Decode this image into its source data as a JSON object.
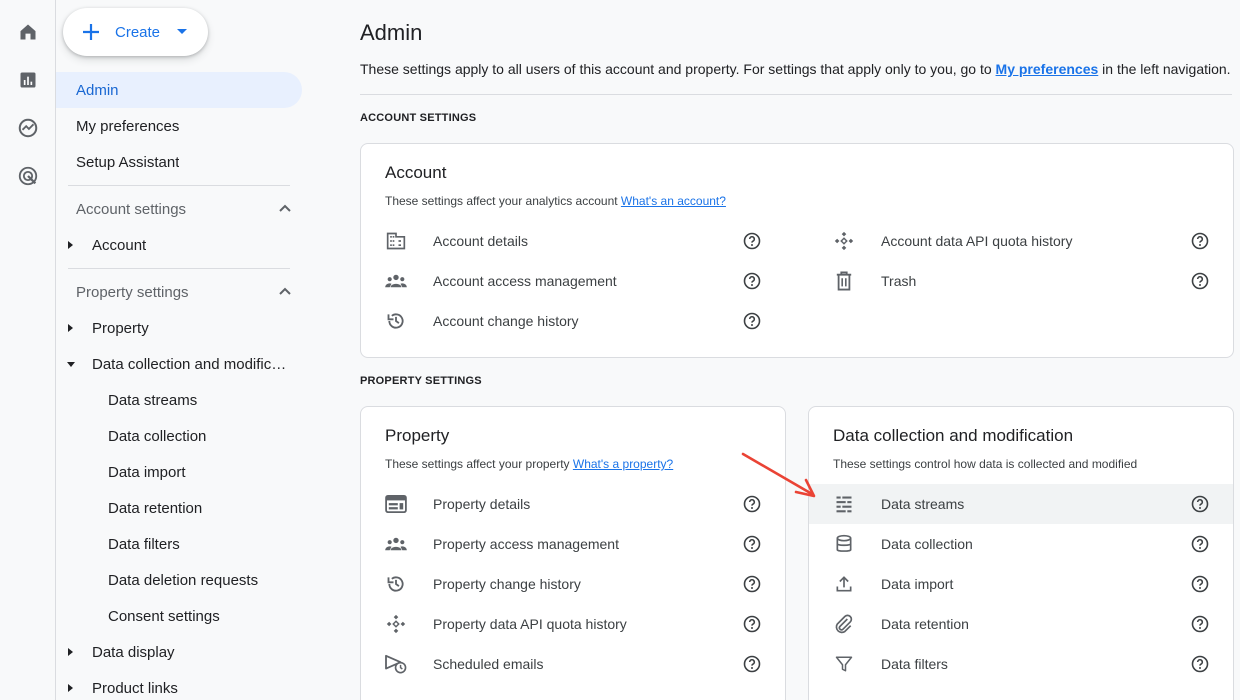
{
  "nav": {
    "create_label": "Create",
    "items": {
      "admin": "Admin",
      "my_preferences": "My preferences",
      "setup_assistant": "Setup Assistant"
    },
    "account_settings": {
      "header": "Account settings",
      "account": "Account"
    },
    "property_settings": {
      "header": "Property settings",
      "property": "Property",
      "data_collection": "Data collection and modification",
      "children": [
        "Data streams",
        "Data collection",
        "Data import",
        "Data retention",
        "Data filters",
        "Data deletion requests",
        "Consent settings"
      ],
      "data_display": "Data display",
      "product_links": "Product links"
    }
  },
  "main": {
    "title": "Admin",
    "description_prefix": "These settings apply to all users of this account and property. For settings that apply only to you, go to ",
    "description_link": "My preferences",
    "description_suffix": " in the left navigation.",
    "account_section_label": "ACCOUNT SETTINGS",
    "property_section_label": "PROPERTY SETTINGS",
    "account_card": {
      "title": "Account",
      "subtitle": "These settings affect your analytics account ",
      "subtitle_link": "What's an account?",
      "left_rows": [
        "Account details",
        "Account access management",
        "Account change history"
      ],
      "right_rows": [
        "Account data API quota history",
        "Trash"
      ]
    },
    "property_card": {
      "title": "Property",
      "subtitle": "These settings affect your property ",
      "subtitle_link": "What's a property?",
      "rows": [
        "Property details",
        "Property access management",
        "Property change history",
        "Property data API quota history",
        "Scheduled emails"
      ]
    },
    "data_card": {
      "title": "Data collection and modification",
      "subtitle": "These settings control how data is collected and modified",
      "rows": [
        "Data streams",
        "Data collection",
        "Data import",
        "Data retention",
        "Data filters"
      ]
    }
  },
  "colors": {
    "accent": "#1a73e8",
    "active_nav_bg": "#e8f0fe",
    "arrow": "#ea4335"
  }
}
